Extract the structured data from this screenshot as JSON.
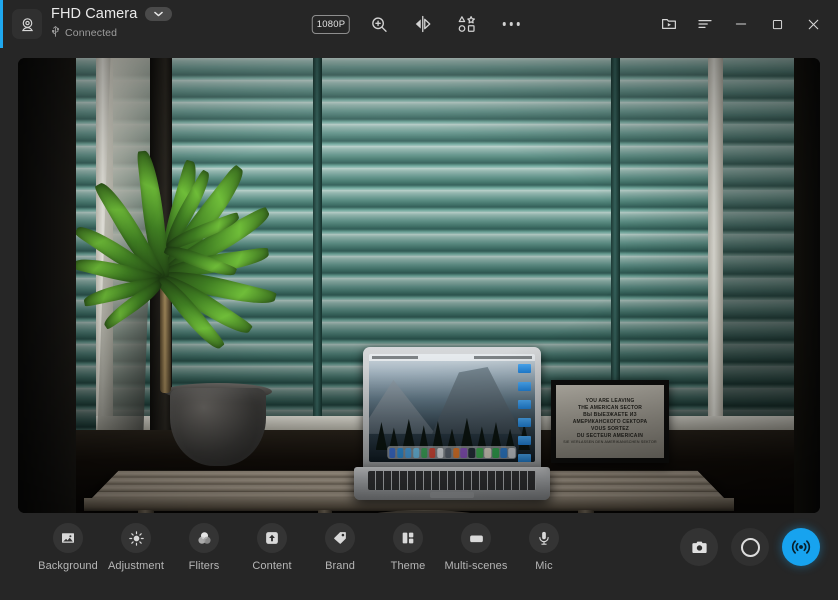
{
  "window": {
    "accent_color": "#1fa8ef",
    "titlebar_bg": "#262626"
  },
  "device": {
    "icon": "webcam-icon",
    "name": "FHD Camera",
    "dropdown_icon": "chevron-down-icon",
    "status_icon": "usb-icon",
    "status": "Connected"
  },
  "toolbar": {
    "resolution_label": "1080P",
    "items": [
      {
        "icon": "resolution-badge",
        "label": "1080P"
      },
      {
        "icon": "zoom-in-icon",
        "label": "Zoom"
      },
      {
        "icon": "mirror-flip-icon",
        "label": "Mirror"
      },
      {
        "icon": "shapes-stickers-icon",
        "label": "Stickers"
      },
      {
        "icon": "more-options-icon",
        "label": "More"
      }
    ]
  },
  "window_controls": [
    {
      "icon": "media-folder-icon",
      "label": "Media"
    },
    {
      "icon": "menu-icon",
      "label": "Menu"
    },
    {
      "icon": "minimize-icon",
      "label": "Minimize"
    },
    {
      "icon": "maximize-icon",
      "label": "Maximize"
    },
    {
      "icon": "close-icon",
      "label": "Close"
    }
  ],
  "preview": {
    "description": "Live camera preview: desk by a window with teal blinds, potted dracaena plant, open MacBook Pro and a framed poster",
    "laptop_screen": {
      "wallpaper": "Yosemite Half Dome",
      "dock_visible": true,
      "desktop_icon_count": 6
    },
    "poster": {
      "line1": "YOU ARE LEAVING",
      "line2": "THE AMERICAN SECTOR",
      "line3": "ВЫ ВЫЕЗЖАЕТЕ ИЗ",
      "line4": "АМЕРИКАНСКОГО СЕКТОРА",
      "line5": "VOUS SORTEZ",
      "line6": "DU SECTEUR AMERICAIN",
      "line7": "SIE VERLASSEN DEN AMERIKANISCHEN SEKTOR"
    }
  },
  "tools": [
    {
      "icon": "image-icon",
      "label": "Background"
    },
    {
      "icon": "brightness-icon",
      "label": "Adjustment"
    },
    {
      "icon": "filters-icon",
      "label": "Fliters"
    },
    {
      "icon": "upload-icon",
      "label": "Content"
    },
    {
      "icon": "tag-icon",
      "label": "Brand"
    },
    {
      "icon": "layout-icon",
      "label": "Theme"
    },
    {
      "icon": "scenes-icon",
      "label": "Multi-scenes"
    },
    {
      "icon": "microphone-icon",
      "label": "Mic"
    }
  ],
  "capture": [
    {
      "icon": "camera-icon",
      "label": "Snapshot",
      "active": false
    },
    {
      "icon": "record-icon",
      "label": "Record",
      "active": false
    },
    {
      "icon": "broadcast-icon",
      "label": "Live",
      "active": true,
      "color": "#17a3ef"
    }
  ]
}
